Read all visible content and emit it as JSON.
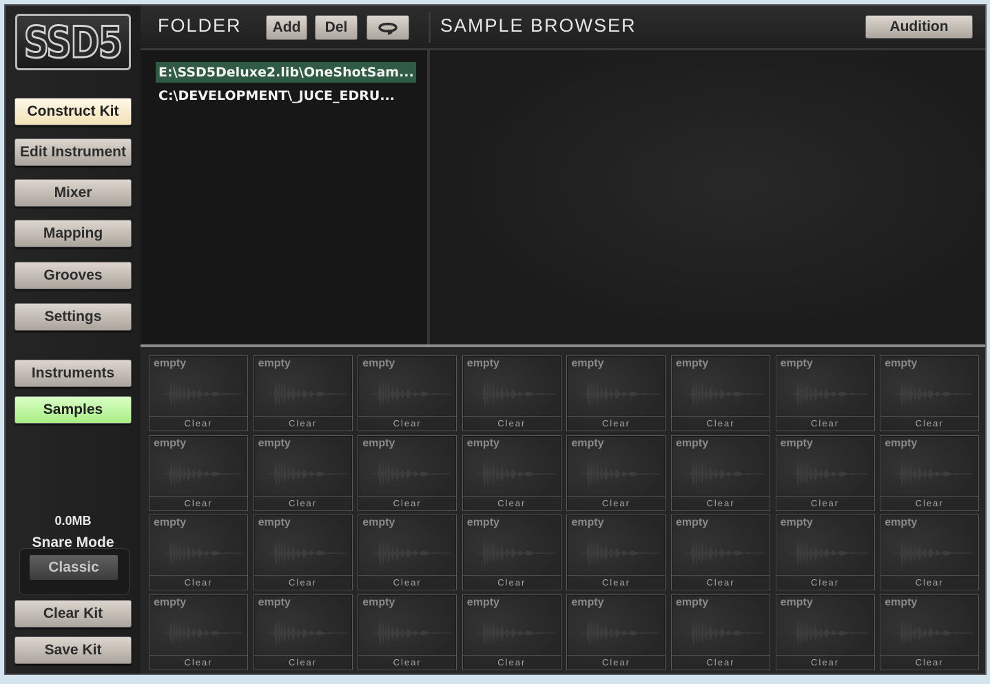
{
  "logo": "SSD5",
  "sidebar": {
    "nav": [
      {
        "label": "Construct Kit"
      },
      {
        "label": "Edit Instrument"
      },
      {
        "label": "Mixer"
      },
      {
        "label": "Mapping"
      },
      {
        "label": "Grooves"
      },
      {
        "label": "Settings"
      }
    ],
    "modes": [
      {
        "label": "Instruments"
      },
      {
        "label": "Samples"
      }
    ],
    "memory": "0.0MB",
    "snare_mode_label": "Snare Mode",
    "snare_mode_value": "Classic",
    "clear_kit": "Clear Kit",
    "save_kit": "Save Kit"
  },
  "topbar": {
    "folder_label": "FOLDER",
    "add": "Add",
    "del": "Del",
    "sample_browser_label": "SAMPLE BROWSER",
    "audition": "Audition"
  },
  "folders": [
    {
      "path": "E:\\SSD5Deluxe2.lib\\OneShotSam...",
      "selected": true
    },
    {
      "path": "C:\\DEVELOPMENT\\_JUCE_EDRU...",
      "selected": false
    }
  ],
  "pads": {
    "empty_label": "empty",
    "clear_label": "Clear",
    "rows": 4,
    "cols": 8
  },
  "colors": {
    "selected_folder": "#2f5a43",
    "active_construct": "#f2e2b6",
    "active_samples": "#a9ee86"
  }
}
